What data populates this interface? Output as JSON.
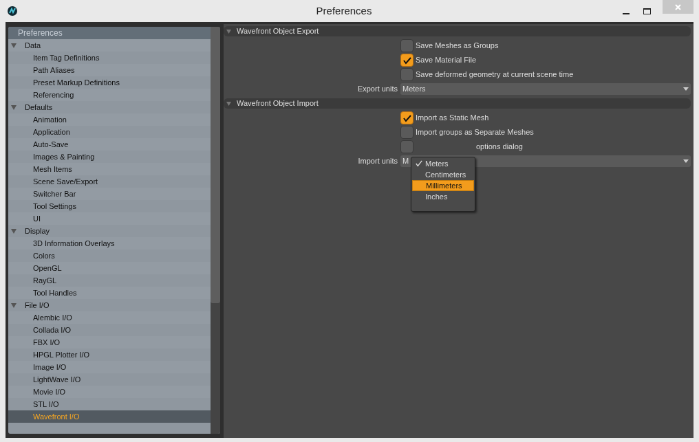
{
  "window": {
    "title": "Preferences"
  },
  "tree": {
    "header": "Preferences",
    "categories": [
      {
        "label": "Data",
        "expanded": true,
        "children": [
          {
            "label": "Item Tag Definitions",
            "selected": false
          },
          {
            "label": "Path Aliases",
            "selected": false
          },
          {
            "label": "Preset Markup Definitions",
            "selected": false
          },
          {
            "label": "Referencing",
            "selected": false
          }
        ]
      },
      {
        "label": "Defaults",
        "expanded": true,
        "children": [
          {
            "label": "Animation",
            "selected": false
          },
          {
            "label": "Application",
            "selected": false
          },
          {
            "label": "Auto-Save",
            "selected": false
          },
          {
            "label": "Images & Painting",
            "selected": false
          },
          {
            "label": "Mesh Items",
            "selected": false
          },
          {
            "label": "Scene Save/Export",
            "selected": false
          },
          {
            "label": "Switcher Bar",
            "selected": false
          },
          {
            "label": "Tool Settings",
            "selected": false
          },
          {
            "label": "UI",
            "selected": false
          }
        ]
      },
      {
        "label": "Display",
        "expanded": true,
        "children": [
          {
            "label": "3D Information Overlays",
            "selected": false
          },
          {
            "label": "Colors",
            "selected": false
          },
          {
            "label": "OpenGL",
            "selected": false
          },
          {
            "label": "RayGL",
            "selected": false
          },
          {
            "label": "Tool Handles",
            "selected": false
          }
        ]
      },
      {
        "label": "File I/O",
        "expanded": true,
        "children": [
          {
            "label": "Alembic I/O",
            "selected": false
          },
          {
            "label": "Collada I/O",
            "selected": false
          },
          {
            "label": "FBX I/O",
            "selected": false
          },
          {
            "label": "HPGL Plotter I/O",
            "selected": false
          },
          {
            "label": "Image I/O",
            "selected": false
          },
          {
            "label": "LightWave I/O",
            "selected": false
          },
          {
            "label": "Movie I/O",
            "selected": false
          },
          {
            "label": "STL I/O",
            "selected": false
          },
          {
            "label": "Wavefront I/O",
            "selected": true
          }
        ]
      }
    ]
  },
  "sections": [
    {
      "title": "Wavefront Object Export",
      "expanded": true,
      "rows": [
        {
          "kind": "checkbox",
          "label": "Save Meshes as Groups",
          "checked": false
        },
        {
          "kind": "checkbox",
          "label": "Save Material File",
          "checked": true
        },
        {
          "kind": "checkbox",
          "label": "Save deformed geometry at current scene time",
          "checked": false
        },
        {
          "kind": "dropdown",
          "label": "Export units",
          "value": "Meters"
        }
      ]
    },
    {
      "title": "Wavefront Object Import",
      "expanded": true,
      "rows": [
        {
          "kind": "checkbox",
          "label": "Import as Static Mesh",
          "checked": true
        },
        {
          "kind": "checkbox",
          "label": "Import groups as Separate Meshes",
          "checked": false
        },
        {
          "kind": "checkbox",
          "label": "options dialog",
          "checked": false,
          "covered": true
        },
        {
          "kind": "dropdown",
          "label": "Import units",
          "value": "M"
        }
      ]
    }
  ],
  "popup_menu": {
    "items": [
      {
        "label": "Meters",
        "checked": true,
        "selected": false
      },
      {
        "label": "Centimeters",
        "checked": false,
        "selected": false
      },
      {
        "label": "Millimeters",
        "checked": false,
        "selected": true
      },
      {
        "label": "Inches",
        "checked": false,
        "selected": false
      }
    ]
  }
}
